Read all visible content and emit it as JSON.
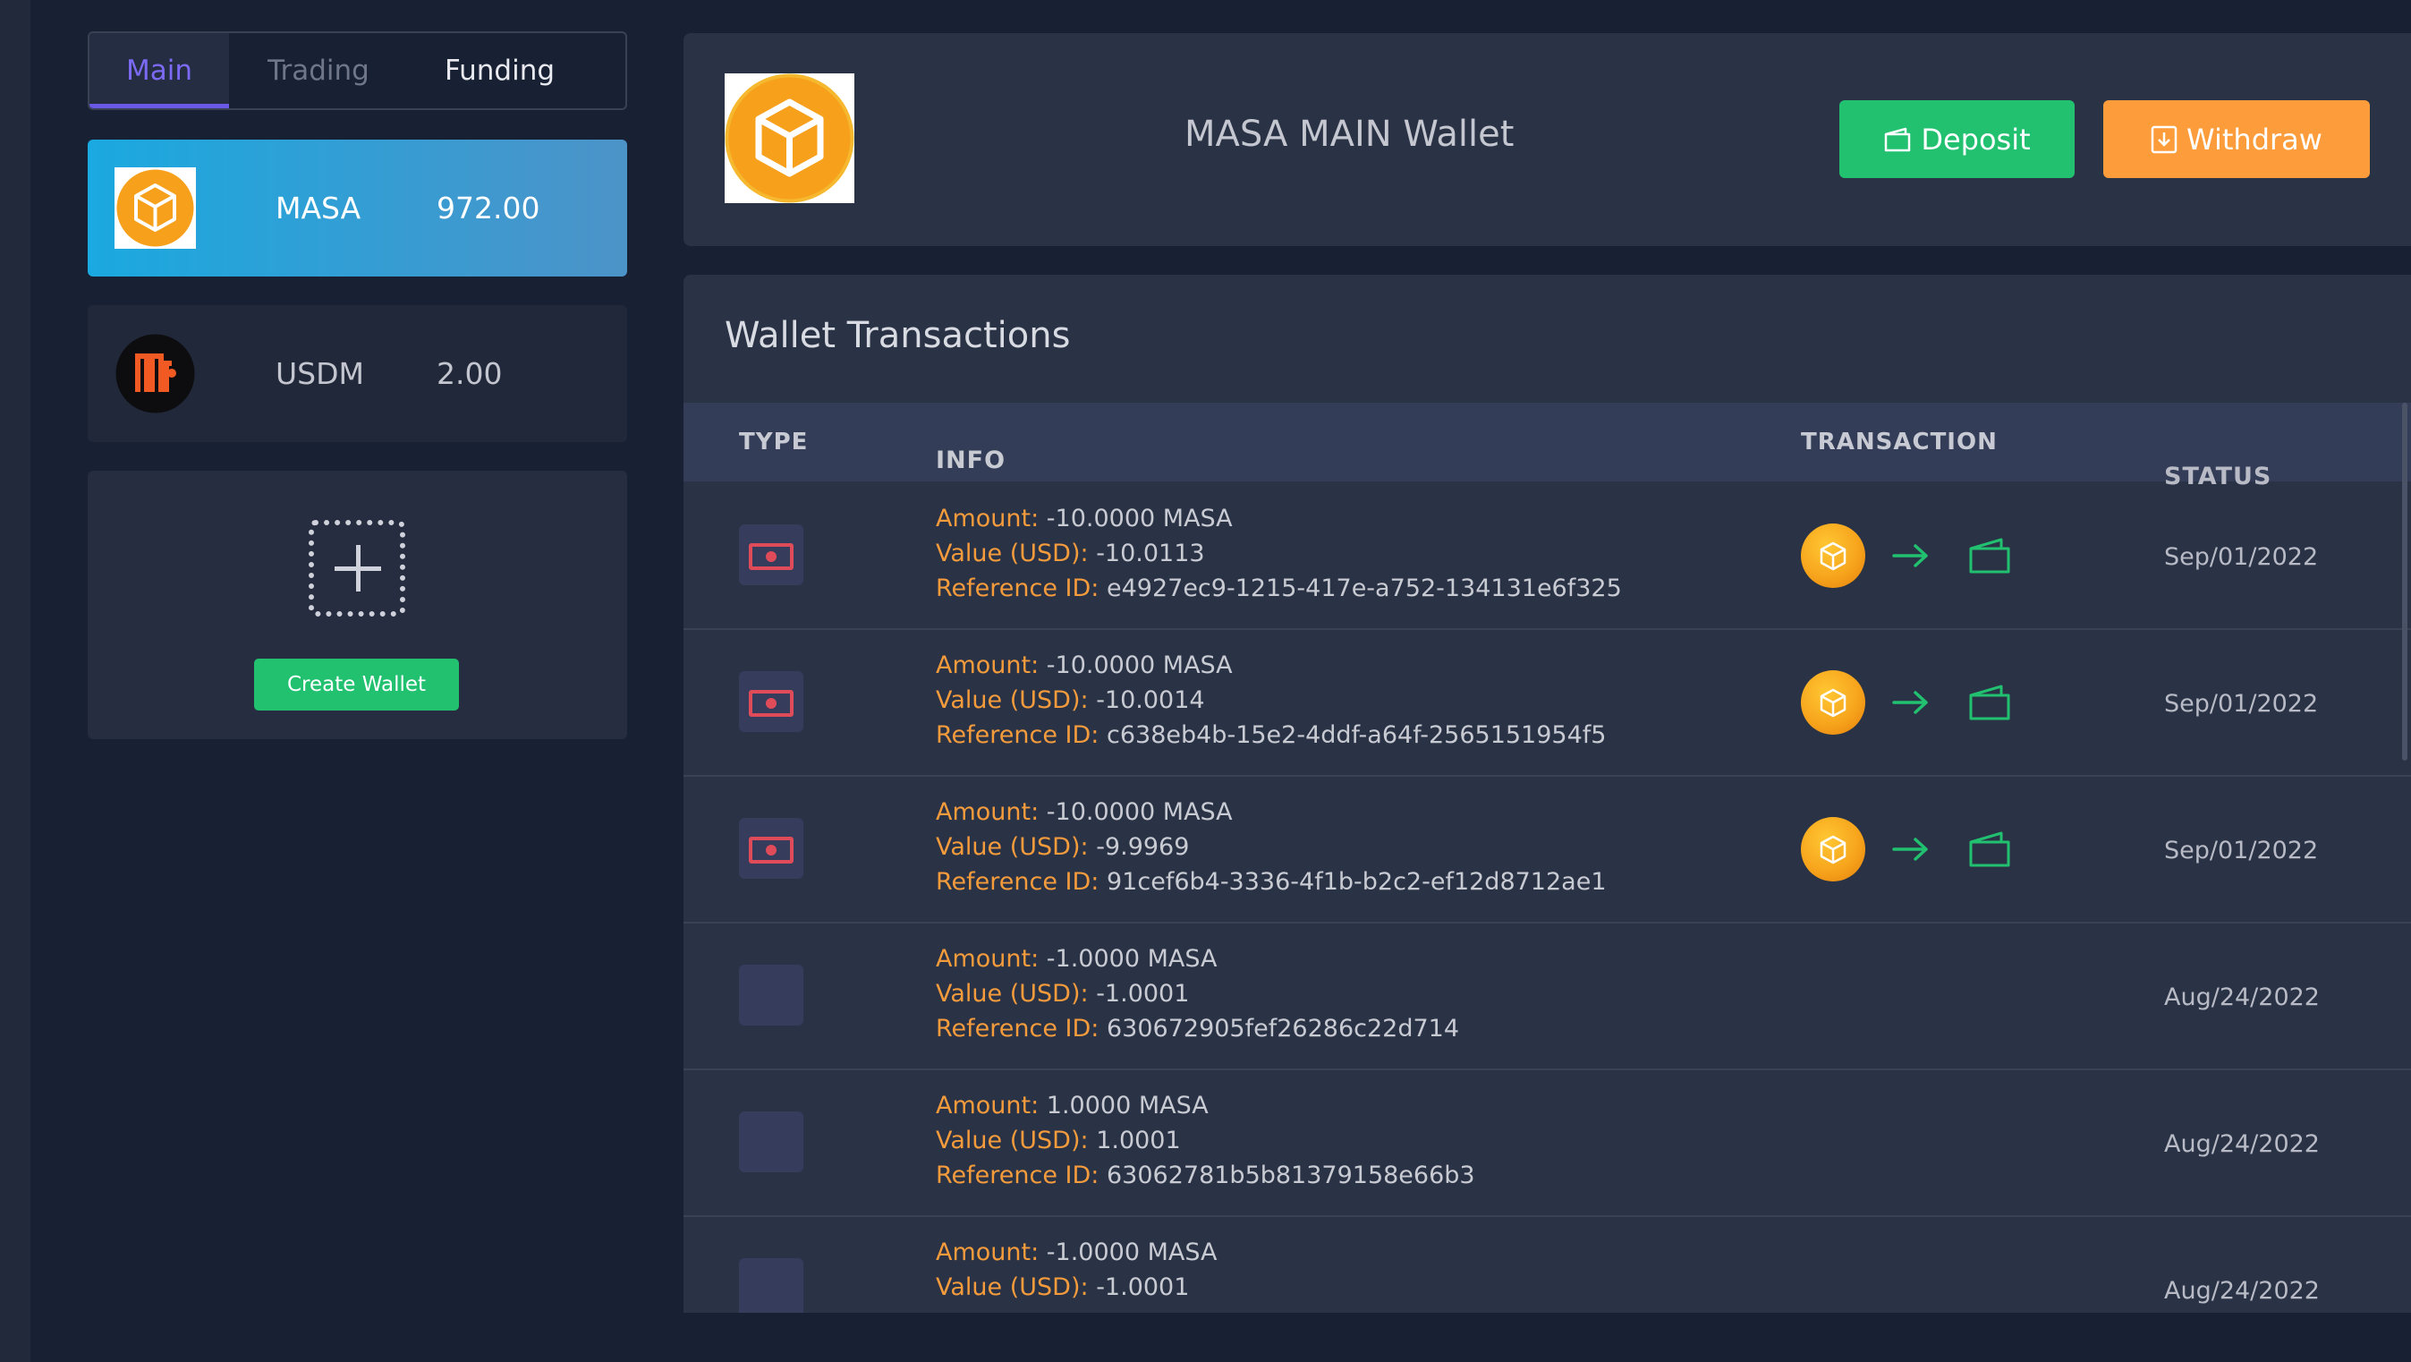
{
  "tabs": [
    {
      "label": "Main",
      "active": true
    },
    {
      "label": "Trading",
      "active": false
    },
    {
      "label": "Funding",
      "active": false
    }
  ],
  "wallets": [
    {
      "name": "MASA",
      "balance": "972.00",
      "icon": "masa-cube-icon",
      "selected": true
    },
    {
      "name": "USDM",
      "balance": "2.00",
      "icon": "usdm-logo-icon",
      "selected": false
    }
  ],
  "create_wallet": {
    "label": "Create Wallet",
    "icon": "add-icon"
  },
  "header": {
    "title": "MASA MAIN Wallet",
    "deposit_label": "Deposit",
    "withdraw_label": "Withdraw"
  },
  "transactions": {
    "title": "Wallet Transactions",
    "columns": [
      "TYPE",
      "INFO",
      "TRANSACTION",
      "STATUS"
    ],
    "labels": {
      "amount": "Amount:",
      "value": "Value (USD):",
      "reference": "Reference ID:"
    },
    "rows": [
      {
        "type_icon": "money-icon",
        "amount": "-10.0000 MASA",
        "value": "-10.0113",
        "reference": "e4927ec9-1215-417e-a752-134131e6f325",
        "has_flow": true,
        "status": "Sep/01/2022"
      },
      {
        "type_icon": "money-icon",
        "amount": "-10.0000 MASA",
        "value": "-10.0014",
        "reference": "c638eb4b-15e2-4ddf-a64f-2565151954f5",
        "has_flow": true,
        "status": "Sep/01/2022"
      },
      {
        "type_icon": "money-icon",
        "amount": "-10.0000 MASA",
        "value": "-9.9969",
        "reference": "91cef6b4-3336-4f1b-b2c2-ef12d8712ae1",
        "has_flow": true,
        "status": "Sep/01/2022"
      },
      {
        "type_icon": "",
        "amount": "-1.0000 MASA",
        "value": "-1.0001",
        "reference": "630672905fef26286c22d714",
        "has_flow": false,
        "status": "Aug/24/2022"
      },
      {
        "type_icon": "",
        "amount": "1.0000 MASA",
        "value": "1.0001",
        "reference": "63062781b5b81379158e66b3",
        "has_flow": false,
        "status": "Aug/24/2022"
      },
      {
        "type_icon": "",
        "amount": "-1.0000 MASA",
        "value": "-1.0001",
        "reference": "",
        "has_flow": false,
        "status": "Aug/24/2022"
      }
    ]
  },
  "colors": {
    "background": "#182033",
    "card": "#2a3246",
    "accent_purple": "#7c6af5",
    "deposit_green": "#21c170",
    "withdraw_orange": "#fd9c3a",
    "label_orange": "#f49b3c",
    "money_red": "#e04b5a"
  }
}
